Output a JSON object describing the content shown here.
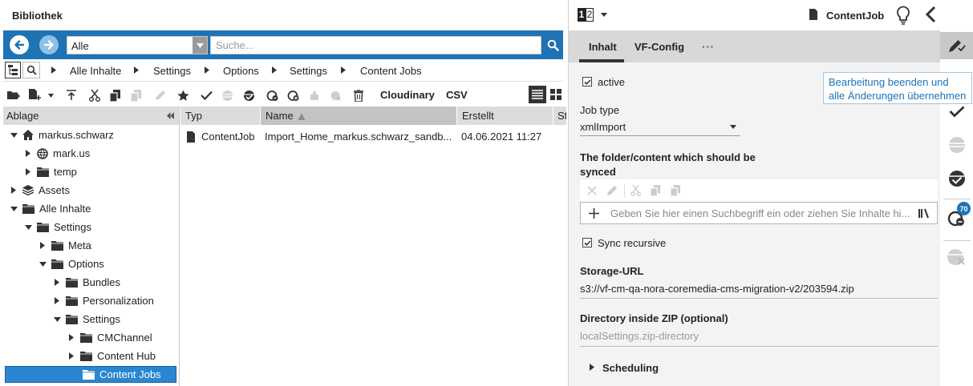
{
  "library": {
    "title": "Bibliothek"
  },
  "search": {
    "scope": "Alle",
    "placeholder": "Suche..."
  },
  "breadcrumb": [
    "Alle Inhalte",
    "Settings",
    "Options",
    "Settings",
    "Content Jobs"
  ],
  "toolbar": {
    "cloudinary_label": "Cloudinary",
    "csv_label": "CSV"
  },
  "tree": {
    "header": "Ablage",
    "items": [
      {
        "label": "markus.schwarz",
        "icon": "home-icon"
      },
      {
        "label": "mark.us",
        "icon": "globe-icon"
      },
      {
        "label": "temp",
        "icon": "folder-icon"
      },
      {
        "label": "Assets",
        "icon": "assets-icon"
      },
      {
        "label": "Alle Inhalte",
        "icon": "folder-icon"
      },
      {
        "label": "Settings",
        "icon": "folder-icon"
      },
      {
        "label": "Meta",
        "icon": "folder-icon"
      },
      {
        "label": "Options",
        "icon": "folder-icon"
      },
      {
        "label": "Bundles",
        "icon": "folder-icon"
      },
      {
        "label": "Personalization",
        "icon": "folder-icon"
      },
      {
        "label": "Settings",
        "icon": "folder-icon"
      },
      {
        "label": "CMChannel",
        "icon": "folder-icon"
      },
      {
        "label": "Content Hub",
        "icon": "folder-icon"
      },
      {
        "label": "Content Jobs",
        "icon": "folder-icon"
      }
    ]
  },
  "grid": {
    "columns": [
      "Typ",
      "Name",
      "Erstellt",
      "St"
    ],
    "rows": [
      {
        "type": "ContentJob",
        "name": "Import_Home_markus.schwarz_sandb...",
        "created": "04.06.2021 11:27"
      }
    ]
  },
  "editor": {
    "view_indicator": "12",
    "doc_type": "ContentJob",
    "tabs": [
      "Inhalt",
      "VF-Config",
      "···"
    ],
    "active_label": "active",
    "job_type_label": "Job type",
    "job_type_value": "xmlImport",
    "folder_label": "The folder/content which should be synced",
    "link_placeholder": "Geben Sie hier einen Suchbegriff ein oder ziehen Sie Inhalte hi...",
    "sync_recursive_label": "Sync recursive",
    "storage_url_label": "Storage-URL",
    "storage_url_value": "s3://vf-cm-qa-nora-coremedia-cms-migration-v2/203594.zip",
    "zip_dir_label": "Directory inside ZIP (optional)",
    "zip_dir_placeholder": "localSettings.zip-directory",
    "scheduling_label": "Scheduling",
    "tooltip": "Bearbeitung beenden und alle Änderungen übernehmen",
    "badge_count": "70"
  },
  "colors": {
    "accent": "#1d73b4",
    "selection": "#2a86d1"
  }
}
